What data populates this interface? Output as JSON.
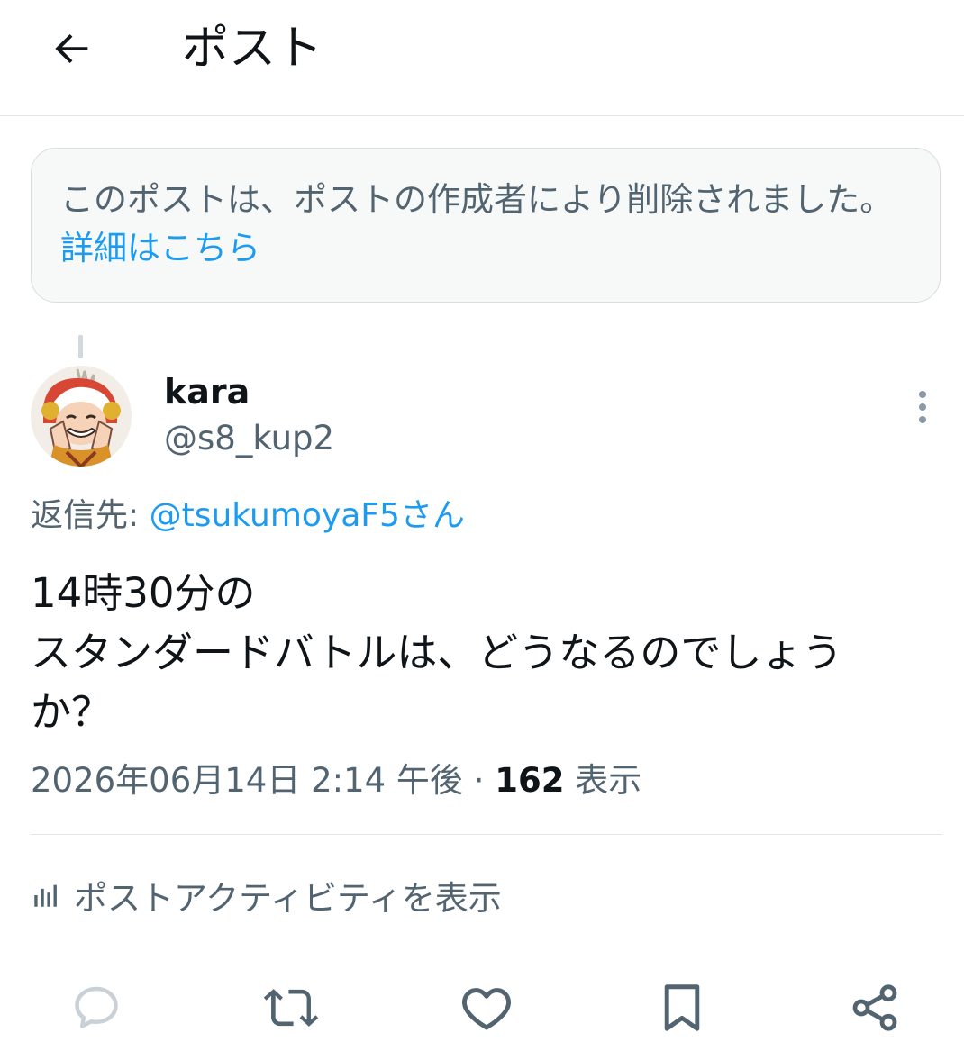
{
  "header": {
    "title": "ポスト",
    "back_icon": "arrow-left-icon"
  },
  "deleted_notice": {
    "text": "このポストは、ポストの作成者により削除されました。",
    "link": "詳細はこちら"
  },
  "post": {
    "display_name": "kara",
    "handle": "@s8_kup2",
    "reply_prefix": "返信先: ",
    "reply_mention": "@tsukumoyaF5さん",
    "text": "14時30分の\nスタンダードバトルは、どうなるのでしょうか？",
    "timestamp": "2026年06月14日 2:14 午後",
    "separator": " · ",
    "views_count": "162",
    "views_label": " 表示",
    "activity_label": "ポストアクティビティを表示"
  },
  "actions": [
    {
      "icon": "reply-icon"
    },
    {
      "icon": "repost-icon"
    },
    {
      "icon": "like-icon"
    },
    {
      "icon": "bookmark-icon"
    },
    {
      "icon": "share-icon"
    }
  ],
  "colors": {
    "accent": "#1d9bf0",
    "secondary_text": "#536471",
    "primary_text": "#0f1419"
  }
}
